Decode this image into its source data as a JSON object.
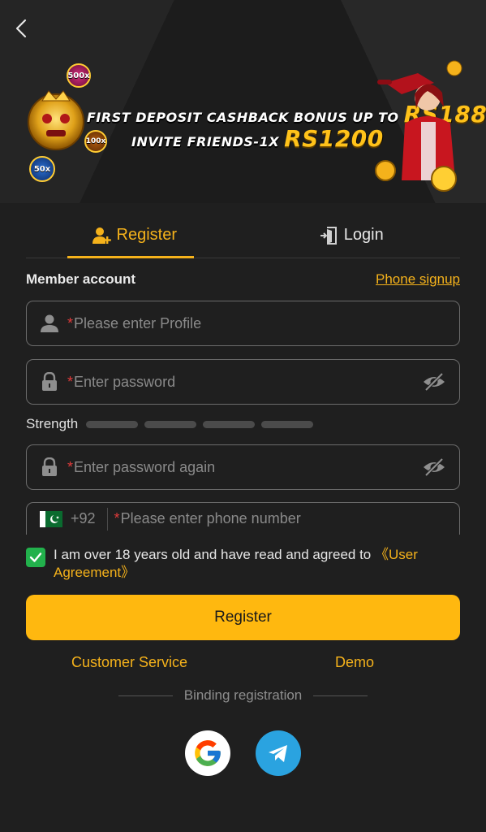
{
  "banner": {
    "line1_text": "FIRST DEPOSIT CASHBACK BONUS UP TO",
    "line1_amount": "RS188",
    "line2_text": "INVITE FRIENDS-1X",
    "line2_amount": "RS1200",
    "badges": [
      "500x",
      "100x",
      "50x"
    ]
  },
  "tabs": [
    {
      "label": "Register",
      "icon": "add-user-icon",
      "active": true
    },
    {
      "label": "Login",
      "icon": "login-door-icon",
      "active": false
    }
  ],
  "form": {
    "section_label": "Member account",
    "phone_signup": "Phone signup",
    "profile_placeholder": "Please enter Profile",
    "password_placeholder": "Enter password",
    "strength_label": "Strength",
    "confirm_placeholder": "Enter password again",
    "country_code": "+92",
    "phone_placeholder": "Please enter phone number",
    "required_mark": "*"
  },
  "agreement": {
    "text": "I am over 18 years old and have read and agreed to ",
    "link": "《User Agreement》",
    "checked": true
  },
  "register_button": "Register",
  "links": {
    "customer_service": "Customer Service",
    "demo": "Demo"
  },
  "binding_label": "Binding registration",
  "social": [
    "google-icon",
    "telegram-icon"
  ],
  "colors": {
    "accent": "#f5b21b",
    "button": "#ffb80f",
    "background": "#1f1f1f",
    "checkbox": "#22b14c",
    "required": "#e03b3b",
    "telegram": "#2aa3e0"
  }
}
